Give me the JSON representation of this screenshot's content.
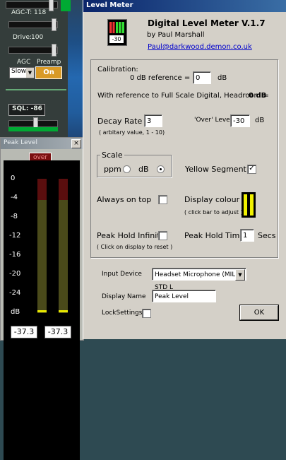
{
  "radio": {
    "agc_t_label": "AGC-T:",
    "agc_t_value": "118",
    "drive_label": "Drive:",
    "drive_value": "100",
    "agc_label": "AGC",
    "preamp_label": "Preamp",
    "agc_select": "Slow",
    "preamp_button": "On",
    "sql_label": "SQL: -86"
  },
  "peak_window": {
    "title": "Peak Level",
    "close": "×",
    "over_button": "over",
    "scale": [
      "0",
      "-4",
      "-8",
      "-12",
      "-16",
      "-20",
      "-24",
      "dB"
    ],
    "readouts": [
      "-37.3",
      "-37.3"
    ]
  },
  "level_meter": {
    "title": "Level Meter",
    "close": "×",
    "logo_value": "-30",
    "app_name": "Digital Level Meter V.1.7",
    "author": "by Paul Marshall",
    "email": "Paul@darkwood.demon.co.uk",
    "calibration_label": "Calibration:",
    "zero_ref_label": "0 dB reference =",
    "zero_ref_value": "0",
    "db_unit": "dB",
    "headroom_text": "With reference to Full Scale Digital, Headroom =",
    "headroom_value": "0 dB",
    "decay_label": "Decay Rate",
    "decay_value": "3",
    "decay_note": "( arbitary value, 1 - 10)",
    "over_level_label": "'Over' Level",
    "over_level_value": "-30",
    "over_unit": "dB",
    "scale_label": "Scale",
    "ppm_label": "ppm",
    "db_scale_label": "dB",
    "scale_selected": "dB",
    "yellow_segment_label": "Yellow Segment",
    "yellow_segment_checked": "✓",
    "always_on_top_label": "Always on top",
    "display_colour_label": "Display colour",
    "click_bar_note": "( click bar to adjust )",
    "peak_hold_label": "Peak Hold Infinite",
    "peak_hold_time_label": "Peak Hold Time",
    "peak_hold_time_value": "1",
    "secs_label": "Secs",
    "reset_note": "( Click on display to reset )",
    "input_device_label": "Input Device",
    "input_device_value": "Headset Microphone (MIL-STD L",
    "display_name_label": "Display Name",
    "display_name_value": "Peak Level",
    "lock_settings_label": "LockSettings",
    "ok_button": "OK"
  },
  "colors": {
    "title_active": "#0a246a",
    "yellow_bar": "#f0f000",
    "meter_bar": "#4a4a1a",
    "meter_top": "#5a0e0e"
  }
}
